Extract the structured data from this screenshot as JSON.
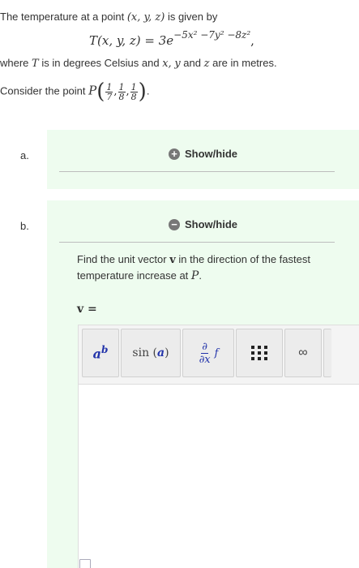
{
  "question": {
    "line1_text": "The temperature at a point",
    "line1_point": "(x, y, z)",
    "line1_end": "is given by",
    "formula_lhs": "T(x, y, z) = 3e",
    "formula_exp": "−5x² −7y² −8z²",
    "formula_comma": ",",
    "line3_where": "where",
    "line3_T": "T",
    "line3_rest": "is in degrees Celsius and",
    "line3_x": "x,",
    "line3_y": "y",
    "line3_and": "and",
    "line3_z": "z",
    "line3_end": "are in metres.",
    "line4_text": "Consider the point",
    "line4_P": "P",
    "point_fracs": [
      {
        "num": "1",
        "den": "7"
      },
      {
        "num": "1",
        "den": "8"
      },
      {
        "num": "1",
        "den": "8"
      }
    ],
    "line4_end": "."
  },
  "parts": [
    {
      "label": "a.",
      "toggle_label": "Show/hide",
      "toggle_icon": "+"
    },
    {
      "label": "b.",
      "toggle_label": "Show/hide",
      "toggle_icon": "−"
    }
  ],
  "part_b": {
    "prompt_start": "Find the unit vector",
    "prompt_v": "v",
    "prompt_mid": "in the direction of the fastest temperature increase at",
    "prompt_P": "P",
    "prompt_end": ".",
    "answer_label": "v =",
    "toolbar": {
      "power_base": "a",
      "power_exp": "b",
      "sin_fn": "sin",
      "sin_arg": "a",
      "deriv_num": "∂",
      "deriv_den": "∂x",
      "deriv_f": "f",
      "infinity": "∞"
    }
  }
}
